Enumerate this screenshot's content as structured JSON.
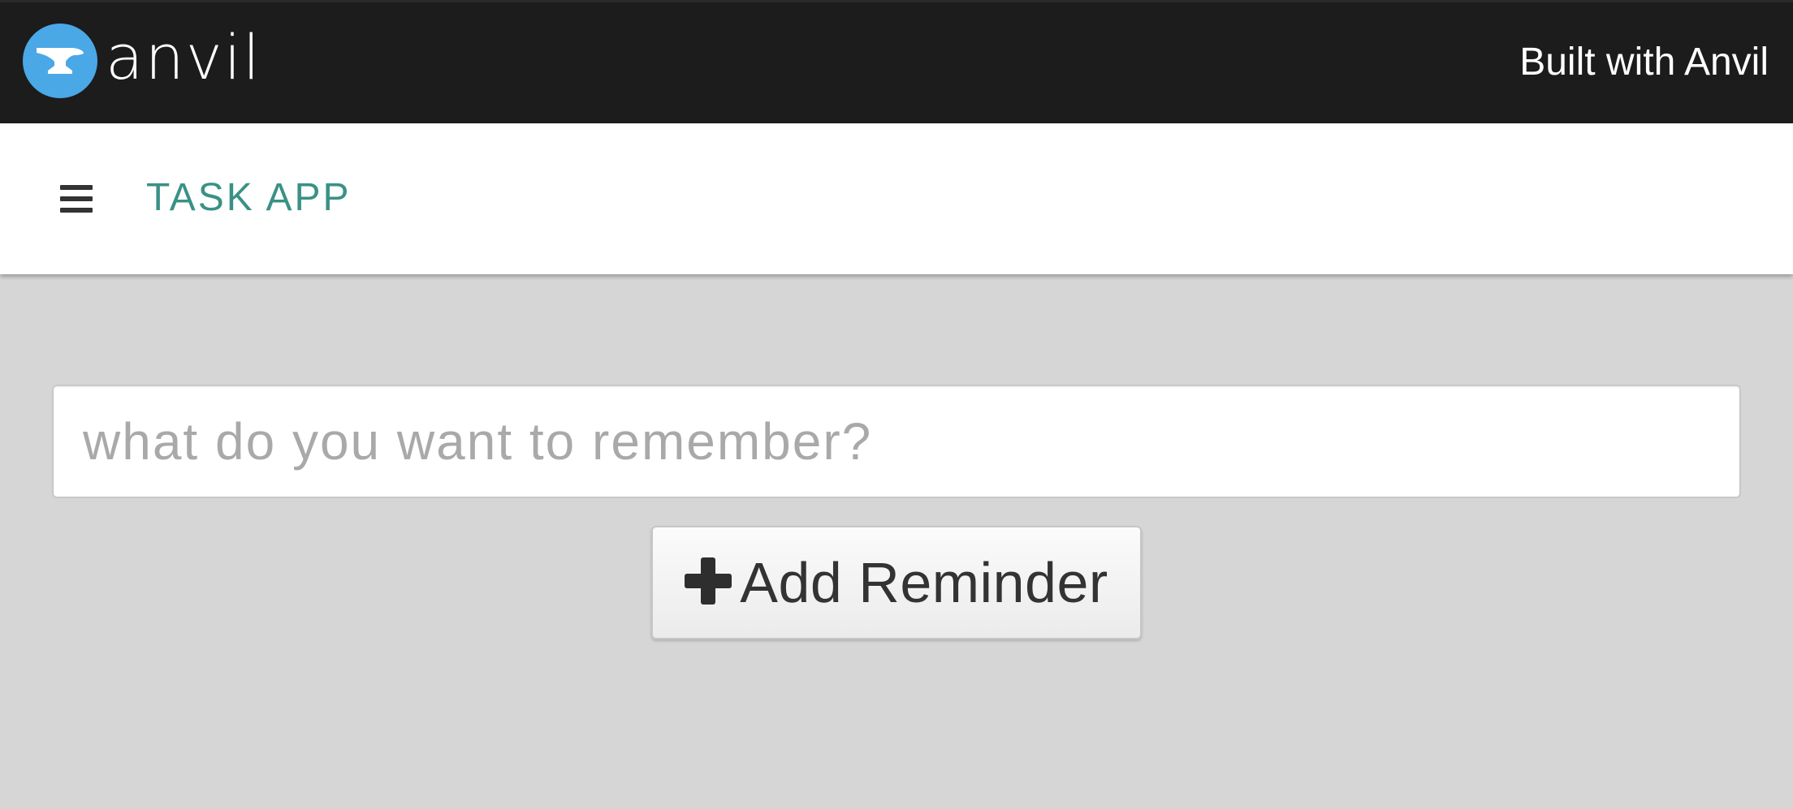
{
  "banner": {
    "logo_text": "anvil",
    "built_with_label": "Built with Anvil"
  },
  "app_bar": {
    "title": "TASK APP"
  },
  "reminder_form": {
    "input_value": "",
    "input_placeholder": "what do you want to remember?",
    "add_button_label": "Add Reminder"
  },
  "icons": {
    "logo": "anvil-logo-icon",
    "menu": "hamburger-menu-icon",
    "add": "plus-icon"
  },
  "colors": {
    "banner_bg": "#1c1c1c",
    "logo_circle": "#4aa8e6",
    "app_title": "#3a9186",
    "page_bg": "#d6d6d6"
  }
}
